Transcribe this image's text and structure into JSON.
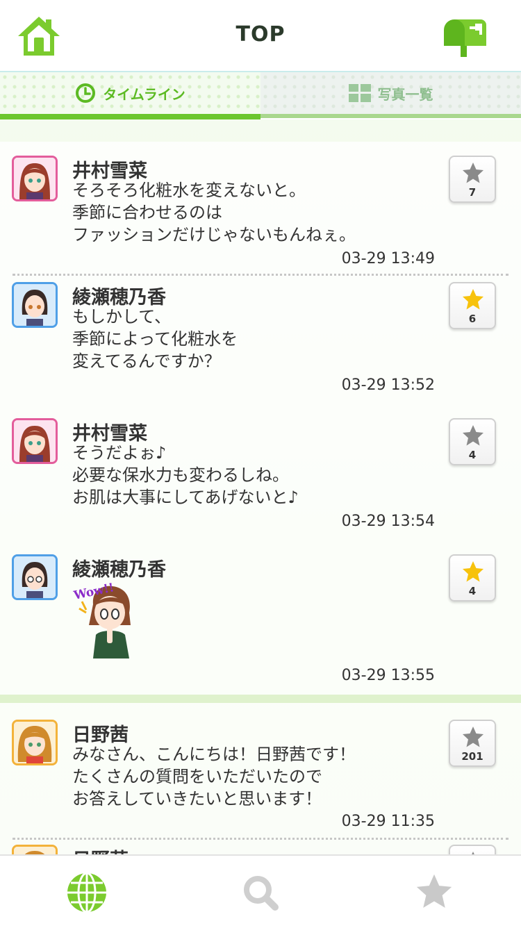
{
  "header": {
    "title": "TOP",
    "home_icon": "home-icon",
    "mail_icon": "mailbox-icon",
    "accent_color": "#7bcb2e"
  },
  "tabs": [
    {
      "label": "タイムライン",
      "icon": "clock-icon",
      "active": true
    },
    {
      "label": "写真一覧",
      "icon": "grid-icon",
      "active": false
    }
  ],
  "posts": [
    {
      "name": "井村雪菜",
      "message": "そろそろ化粧水を変えないと。\n季節に合わせるのは\nファッションだけじゃないもんねぇ。",
      "time": "03-29 13:49",
      "star_count": "7",
      "starred": false
    },
    {
      "name": "綾瀬穂乃香",
      "message": "もしかして、\n季節によって化粧水を\n変えてるんですか？",
      "time": "03-29 13:52",
      "star_count": "6",
      "starred": true
    },
    {
      "name": "井村雪菜",
      "message": "そうだよぉ♪\n必要な保水力も変わるしね。\nお肌は大事にしてあげないと♪",
      "time": "03-29 13:54",
      "star_count": "4",
      "starred": false
    },
    {
      "name": "綾瀬穂乃香",
      "message": "",
      "stamp_text": "Wow!!",
      "time": "03-29 13:55",
      "star_count": "4",
      "starred": true
    },
    {
      "name": "日野茜",
      "message": "みなさん、こんにちは！日野茜です！\nたくさんの質問をいただいたので\nお答えしていきたいと思います！",
      "time": "03-29 11:35",
      "star_count": "201",
      "starred": false
    },
    {
      "name": "日野茜",
      "message": "",
      "time": "",
      "star_count": "",
      "starred": false
    }
  ],
  "bottom_nav": [
    {
      "icon": "globe-icon",
      "active": true
    },
    {
      "icon": "search-icon",
      "active": false
    },
    {
      "icon": "star-icon",
      "active": false
    }
  ]
}
